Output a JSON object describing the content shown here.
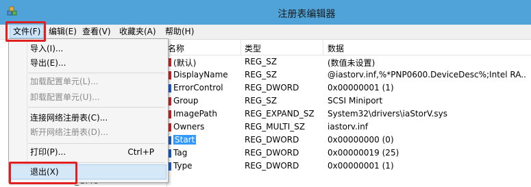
{
  "window": {
    "title": "注册表编辑器"
  },
  "menubar": [
    "文件(F)",
    "编辑(E)",
    "查看(V)",
    "收藏夹(A)",
    "帮助(H)"
  ],
  "file_menu": {
    "import": "导入(I)...",
    "export": "导出(E)...",
    "load_hive": "加载配置单元(L)...",
    "unload_hive": "卸载配置单元(U)...",
    "connect": "连接网络注册表(C)...",
    "disconnect": "断开网络注册表(D)...",
    "print": "打印(P)...",
    "print_shortcut": "Ctrl+P",
    "exit": "退出(X)"
  },
  "tree": {
    "partial_item": "iaLPSSi_GPIO"
  },
  "columns": {
    "name": "名称",
    "type": "类型",
    "data": "数据"
  },
  "rows": [
    {
      "name": "(默认)",
      "type": "REG_SZ",
      "data": "(数值未设置)",
      "icon": "string"
    },
    {
      "name": "DisplayName",
      "type": "REG_SZ",
      "data": "@iastorv.inf,%*PNP0600.DeviceDesc%;Intel RA...",
      "icon": "string"
    },
    {
      "name": "ErrorControl",
      "type": "REG_DWORD",
      "data": "0x00000001 (1)",
      "icon": "binary"
    },
    {
      "name": "Group",
      "type": "REG_SZ",
      "data": "SCSI Miniport",
      "icon": "string"
    },
    {
      "name": "ImagePath",
      "type": "REG_EXPAND_SZ",
      "data": "System32\\drivers\\iaStorV.sys",
      "icon": "string"
    },
    {
      "name": "Owners",
      "type": "REG_MULTI_SZ",
      "data": "iastorv.inf",
      "icon": "string"
    },
    {
      "name": "Start",
      "type": "REG_DWORD",
      "data": "0x00000000 (0)",
      "icon": "binary"
    },
    {
      "name": "Tag",
      "type": "REG_DWORD",
      "data": "0x00000019 (25)",
      "icon": "binary"
    },
    {
      "name": "Type",
      "type": "REG_DWORD",
      "data": "0x00000001 (1)",
      "icon": "binary"
    }
  ],
  "selected_row": "Start",
  "colors": {
    "titlebar": "#4fa3d9",
    "highlight": "#e02020",
    "selection": "#3399ff"
  }
}
